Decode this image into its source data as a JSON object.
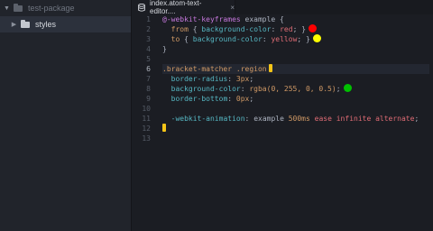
{
  "tree": {
    "root_label": "test-package",
    "items": [
      {
        "label": "styles"
      }
    ]
  },
  "tab": {
    "title": "index.atom-text-editor...."
  },
  "colors": {
    "dot_red": "#ff0000",
    "dot_yellow": "#ffff00",
    "dot_green": "#00c000",
    "cursor": "#f5c518"
  },
  "editor": {
    "current_line": 6,
    "line_numbers": [
      "1",
      "2",
      "3",
      "4",
      "5",
      "6",
      "7",
      "8",
      "9",
      "10",
      "11",
      "12",
      "13"
    ],
    "lines": {
      "l1": {
        "a": "@-webkit-keyframes",
        "b": " example {"
      },
      "l2": {
        "a": "from",
        "b": "{",
        "c": "background-color",
        "d": ":",
        "e": "red",
        "f": "; }"
      },
      "l3": {
        "a": "to",
        "b": "{",
        "c": "background-color",
        "d": ":",
        "e": "yellow",
        "f": "; }"
      },
      "l4": {
        "a": "}"
      },
      "l6": {
        "a": ".bracket-matcher",
        "b": ".region"
      },
      "l7": {
        "a": "border-radius",
        "b": ":",
        "c": "3px",
        "d": ";"
      },
      "l8": {
        "a": "background-color",
        "b": ":",
        "c": "rgba(0, 255, 0, 0.5)",
        "d": ";"
      },
      "l9": {
        "a": "border-bottom",
        "b": ":",
        "c": "0px",
        "d": ";"
      },
      "l11": {
        "a": "-webkit-animation",
        "b": ":",
        "c": "example",
        "d": "500ms",
        "e": "ease infinite alternate",
        "f": ";"
      }
    }
  }
}
